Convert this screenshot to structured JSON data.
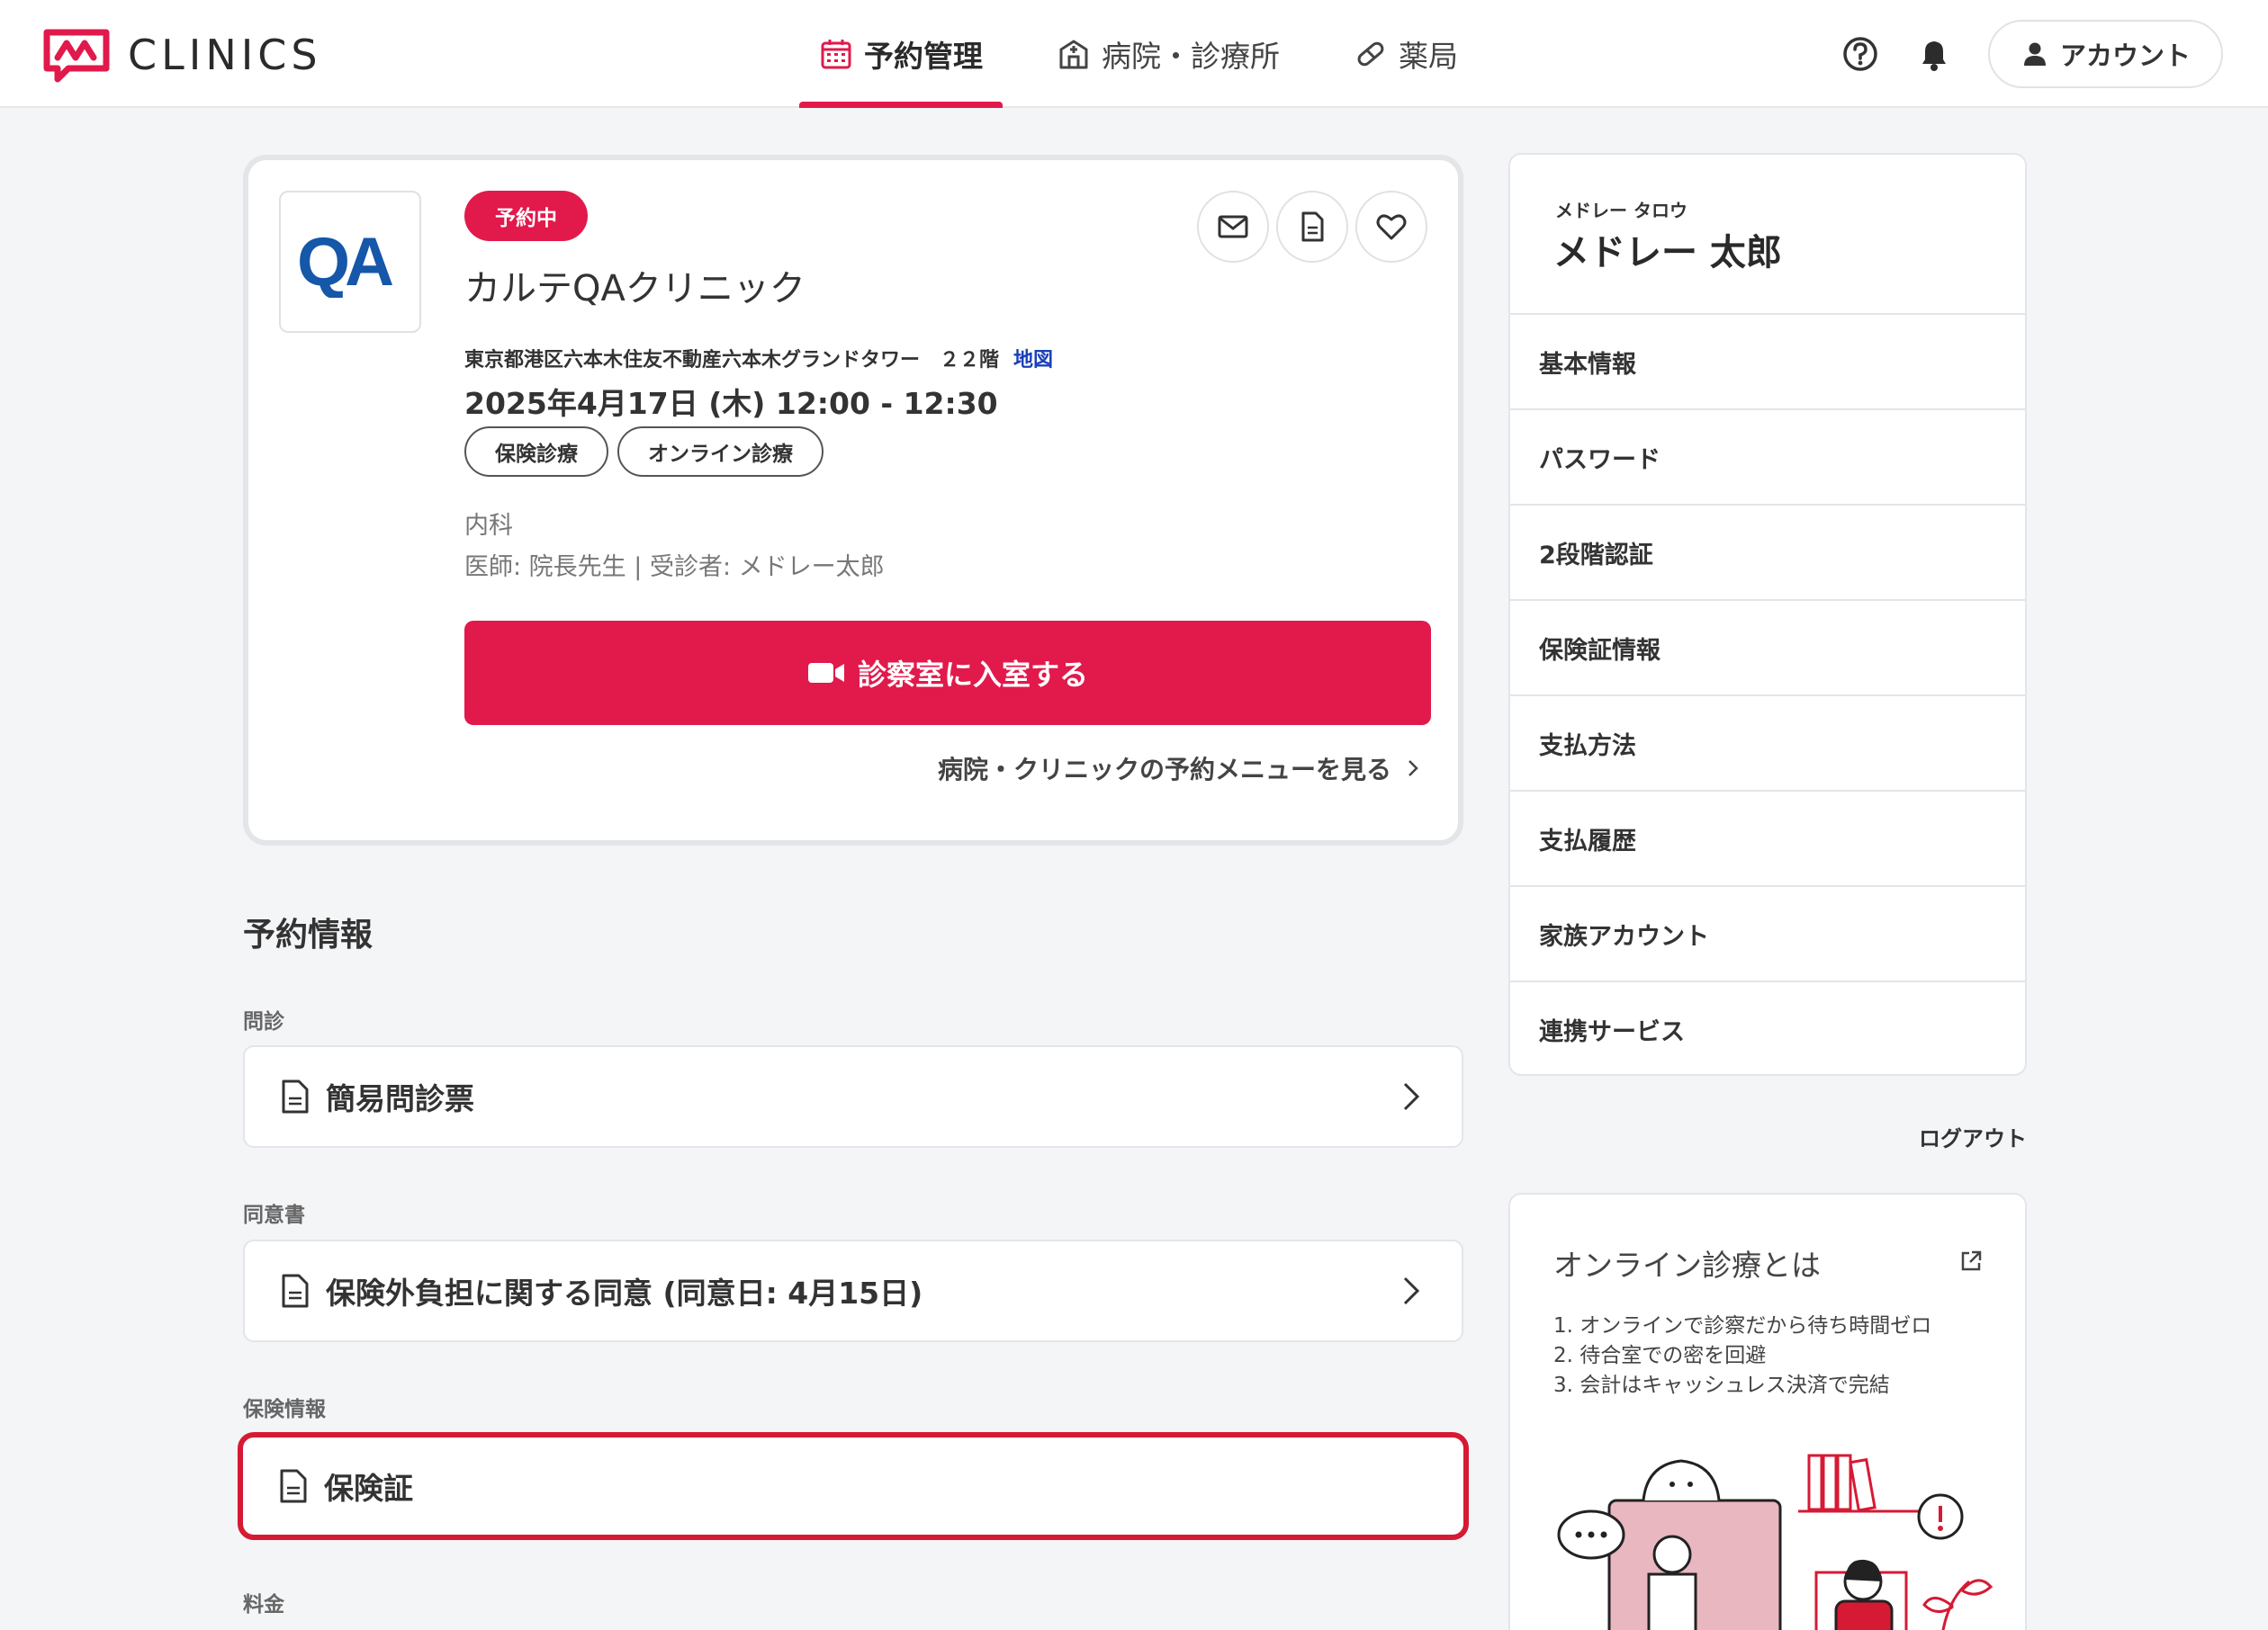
{
  "brand": {
    "name": "CLINICS",
    "accent": "#e2194b"
  },
  "nav": {
    "items": [
      {
        "label": "予約管理",
        "icon": "calendar-icon",
        "active": true
      },
      {
        "label": "病院・診療所",
        "icon": "hospital-icon",
        "active": false
      },
      {
        "label": "薬局",
        "icon": "pill-icon",
        "active": false
      }
    ]
  },
  "header": {
    "account_label": "アカウント"
  },
  "reservation": {
    "clinic_logo_text": "QA",
    "status": "予約中",
    "clinic_name": "カルテQAクリニック",
    "address": "東京都港区六本木住友不動産六本木グランドタワー　２２階",
    "map_label": "地図",
    "datetime": "2025年4月17日 (木) 12:00 - 12:30",
    "tags": [
      "保険診療",
      "オンライン診療"
    ],
    "department": "内科",
    "doctor_line": "医師: 院長先生 | 受診者: メドレー太郎",
    "enter_button": "診察室に入室する",
    "menu_link": "病院・クリニックの予約メニューを見る"
  },
  "info": {
    "title": "予約情報",
    "sections": [
      {
        "label": "問診",
        "item": "簡易問診票",
        "has_chevron": true
      },
      {
        "label": "同意書",
        "item": "保険外負担に関する同意 (同意日: 4月15日)",
        "has_chevron": true
      },
      {
        "label": "保険情報",
        "item": "保険証",
        "has_chevron": false
      },
      {
        "label": "料金"
      }
    ]
  },
  "side": {
    "user_kana": "メドレー タロウ",
    "user_name": "メドレー 太郎",
    "menu": [
      "基本情報",
      "パスワード",
      "2段階認証",
      "保険証情報",
      "支払方法",
      "支払履歴",
      "家族アカウント",
      "連携サービス"
    ],
    "logout": "ログアウト"
  },
  "promo": {
    "title": "オンライン診療とは",
    "points": [
      "1. オンラインで診察だから待ち時間ゼロ",
      "2. 待合室での密を回避",
      "3. 会計はキャッシュレス決済で完結"
    ]
  }
}
